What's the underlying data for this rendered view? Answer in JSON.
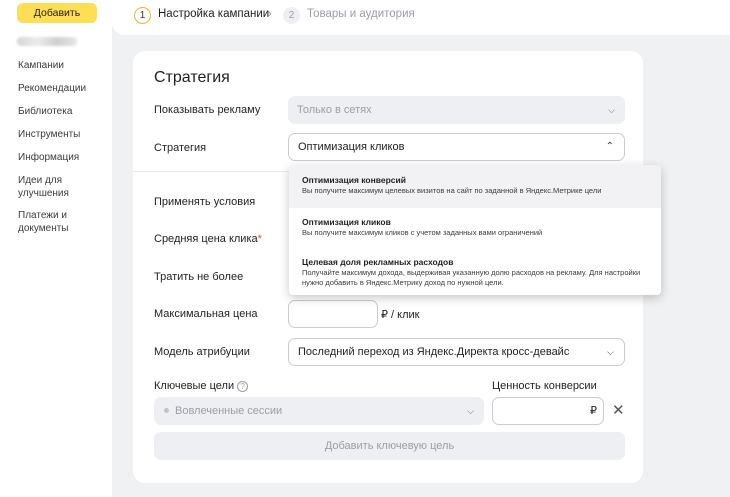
{
  "sidebar": {
    "add_button": "Добавить",
    "items": [
      "Кампании",
      "Рекомендации",
      "Библиотека",
      "Инструменты",
      "Информация",
      "Идеи для улучшения",
      "Платежи и документы"
    ]
  },
  "stepper": {
    "step1_number": "1",
    "step1_label": "Настройка кампании",
    "chevron": "›",
    "step2_number": "2",
    "step2_label": "Товары и аудитория"
  },
  "strategy": {
    "title": "Стратегия",
    "show_ads_label": "Показывать рекламу",
    "show_ads_value": "Только в сетях",
    "strategy_label": "Стратегия",
    "strategy_value": "Оптимизация кликов",
    "apply_conditions_label": "Применять условия",
    "avg_click_price_label": "Средняя цена клика",
    "required_mark": "*",
    "spend_limit_label": "Тратить не более",
    "max_price_label": "Максимальная цена",
    "max_price_unit": "₽ / клик",
    "attribution_label": "Модель атрибуции",
    "attribution_value": "Последний переход из Яндекс.Директа кросс-девайс",
    "key_goals_label": "Ключевые цели",
    "key_goal_value": "Вовлеченные сессии",
    "conversion_value_label": "Ценность конверсии",
    "currency": "₽",
    "add_goal_button": "Добавить ключевую цель"
  },
  "dropdown": {
    "options": [
      {
        "title": "Оптимизация конверсий",
        "desc": "Вы получите максимум целевых визитов на сайт по заданной в Яндекс.Метрике цели"
      },
      {
        "title": "Оптимизация кликов",
        "desc": "Вы получите максимум кликов с учетом заданных вами ограничений"
      },
      {
        "title": "Целевая доля рекламных расходов",
        "desc": "Получайте максимум дохода, выдерживая указанную долю расходов на рекламу. Для настройки нужно добавить в Яндекс.Метрику доход по нужной цели."
      }
    ]
  },
  "icons": {
    "dropdown_chevron": "chevron-down-icon",
    "collapse_chevron": "chevron-up-icon",
    "help": "question-circle-icon",
    "remove": "close-icon"
  },
  "colors": {
    "accent": "#fdde55",
    "step_active_ring": "#f0b429",
    "required": "#e34a3a"
  }
}
